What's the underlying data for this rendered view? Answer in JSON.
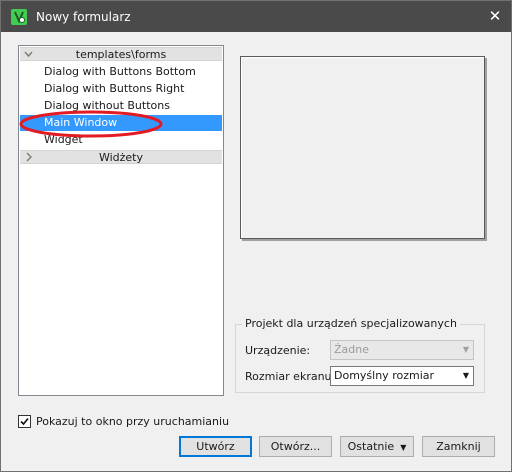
{
  "window": {
    "title": "Nowy formularz",
    "close_glyph": "✕"
  },
  "tree": {
    "category_templates": "templates\\forms",
    "items": [
      "Dialog with Buttons Bottom",
      "Dialog with Buttons Right",
      "Dialog without Buttons",
      "Main Window",
      "Widget"
    ],
    "selected_index": 3,
    "category_widgets": "Widżety"
  },
  "colors": {
    "titlebar": "#4a4a4a",
    "selection": "#3399ff",
    "annotation": "#e31b23",
    "default_button_border": "#0078d7"
  },
  "icons": {
    "app": "qt-designer-icon",
    "expanded": "chevron-down-icon",
    "collapsed": "chevron-right-icon",
    "dropdown": "chevron-down-icon",
    "check": "checkmark-icon"
  },
  "device_group": {
    "legend": "Projekt dla urządzeń specjalizowanych",
    "device_label": "Urządzenie:",
    "device_value": "Żadne",
    "screen_label": "Rozmiar ekranu:",
    "screen_value": "Domyślny rozmiar"
  },
  "footer": {
    "show_on_startup": "Pokazuj to okno przy uruchamianiu",
    "show_on_startup_checked": true,
    "create": "Utwórz",
    "open": "Otwórz...",
    "recent": "Ostatnie",
    "close": "Zamknij"
  }
}
